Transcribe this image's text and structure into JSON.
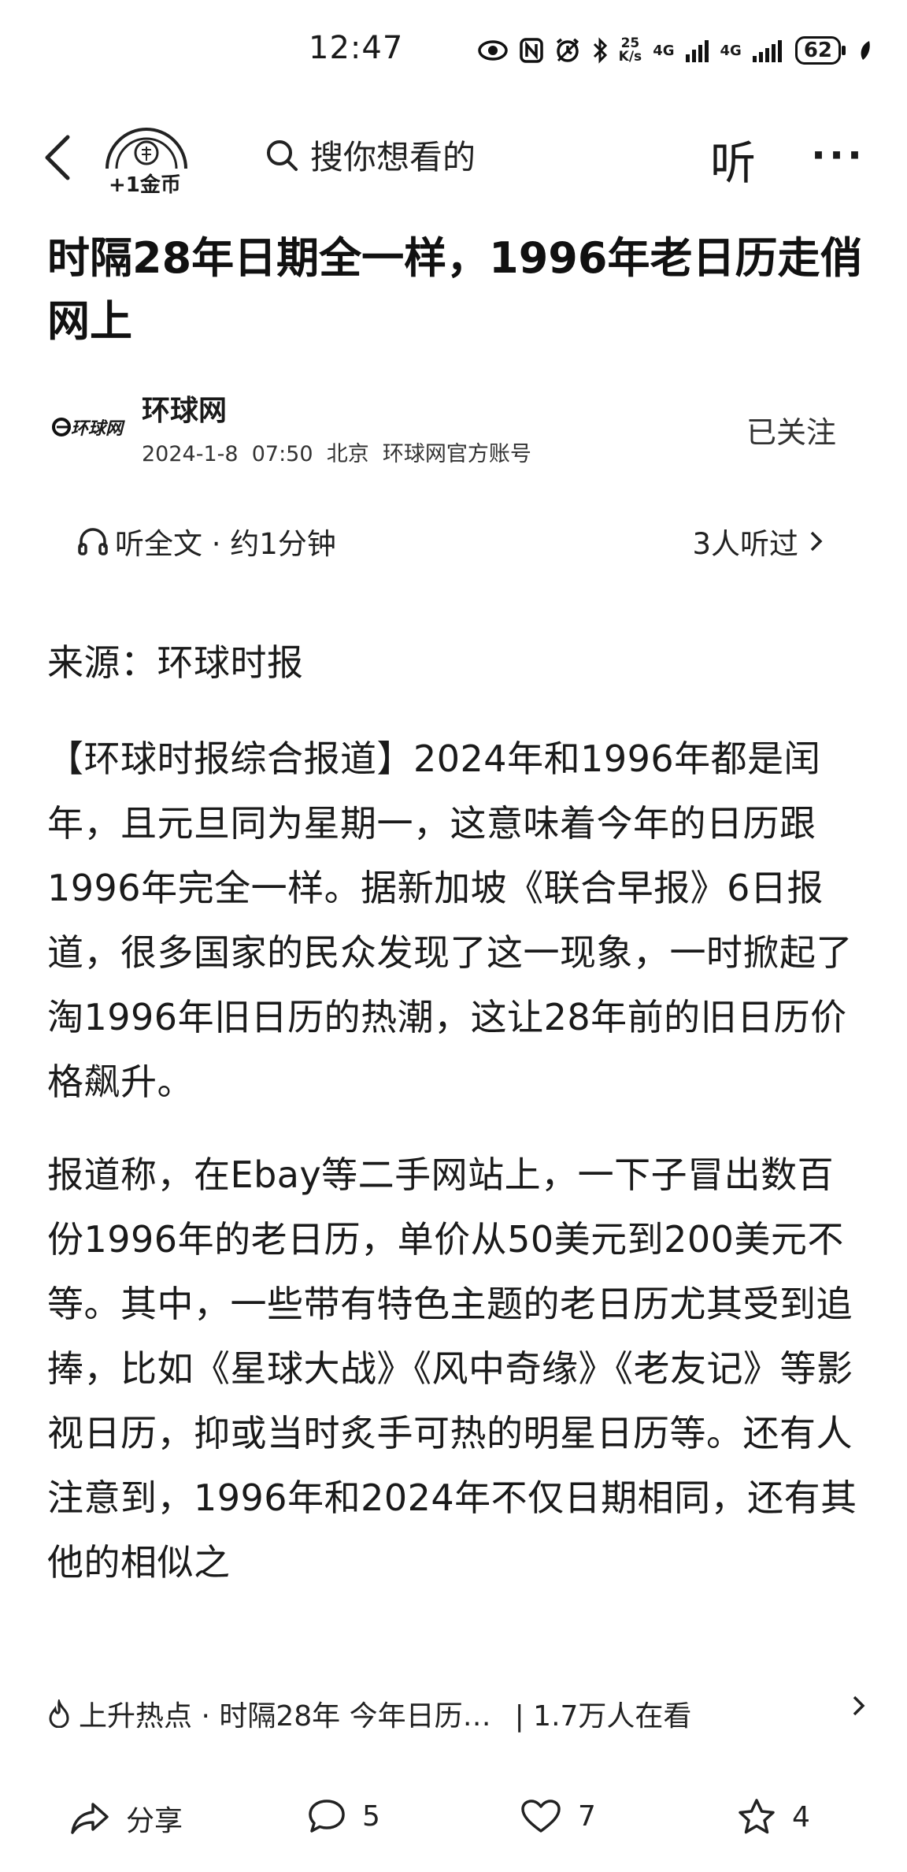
{
  "status_bar": {
    "time": "12:47",
    "net_speed_top": "25",
    "net_speed_bottom": "K/s",
    "signal1": "4G",
    "signal2": "4G",
    "battery": "62"
  },
  "nav": {
    "coin_label": "+1金币",
    "search_placeholder": "搜你想看的",
    "listen_label": "听",
    "more_label": "···"
  },
  "article": {
    "title": "时隔28年日期全一样，1996年老日历走俏网上",
    "author": {
      "name": "环球网",
      "logo_text": "环球网",
      "meta": "2024-1-8  07:50  北京  环球网官方账号",
      "follow_label": "已关注"
    },
    "listen_row": {
      "label": "听全文 · 约1分钟",
      "count": "3人听过"
    },
    "paragraphs": [
      "来源：环球时报",
      "【环球时报综合报道】2024年和1996年都是闰年，且元旦同为星期一，这意味着今年的日历跟1996年完全一样。据新加坡《联合早报》6日报道，很多国家的民众发现了这一现象，一时掀起了淘1996年旧日历的热潮，这让28年前的旧日历价格飙升。",
      "报道称，在Ebay等二手网站上，一下子冒出数百份1996年的老日历，单价从50美元到200美元不等。其中，一些带有特色主题的老日历尤其受到追捧，比如《星球大战》《风中奇缘》《老友记》等影视日历，抑或当时炙手可热的明星日历等。还有人注意到，1996年和2024年不仅日期相同，还有其他的相似之"
    ]
  },
  "hot": {
    "text": "上升热点 · 时隔28年 今年日历…",
    "viewers": "| 1.7万人在看"
  },
  "bottom_bar": {
    "share_label": "分享",
    "comments": "5",
    "likes": "7",
    "favorites": "4"
  }
}
